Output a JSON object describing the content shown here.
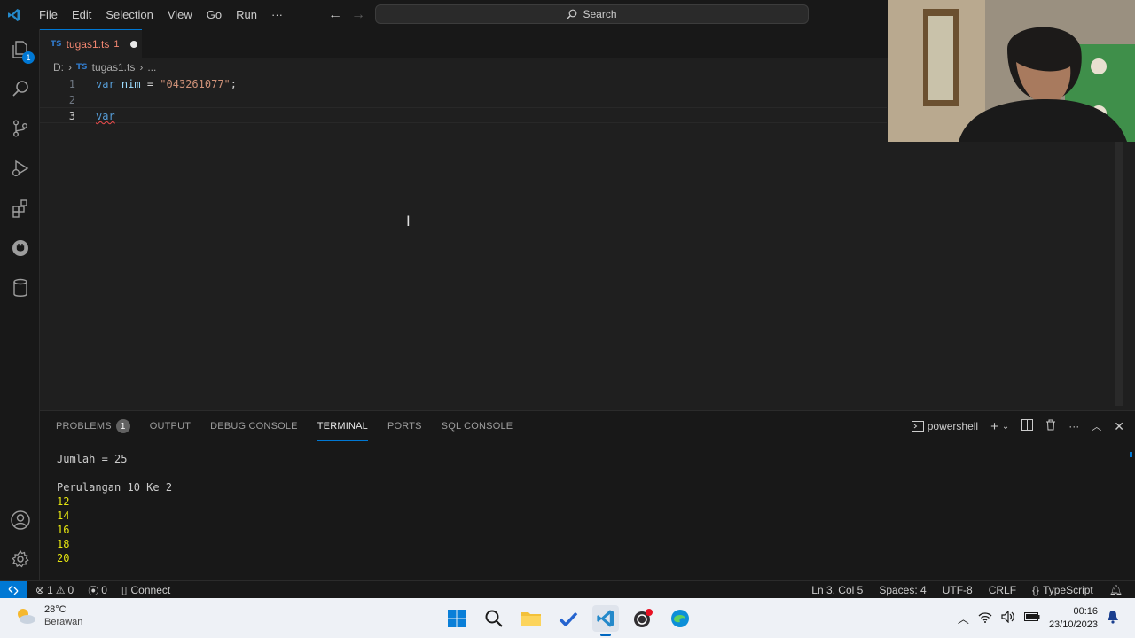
{
  "menu": [
    "File",
    "Edit",
    "Selection",
    "View",
    "Go",
    "Run",
    "···"
  ],
  "search": {
    "label": "Search"
  },
  "activity": {
    "explorer_badge": "1"
  },
  "tab": {
    "lang": "TS",
    "name": "tugas1.ts",
    "problem_count": "1"
  },
  "breadcrumb": {
    "drive": "D:",
    "lang": "TS",
    "file": "tugas1.ts",
    "more": "..."
  },
  "editor": {
    "lines": [
      {
        "no": "1",
        "kw": "var",
        "name": "nim",
        "op": " = ",
        "value": "\"043261077\"",
        "end": ";"
      },
      {
        "no": "2"
      },
      {
        "no": "3",
        "kw": "var"
      }
    ]
  },
  "panel": {
    "tabs": [
      "PROBLEMS",
      "OUTPUT",
      "DEBUG CONSOLE",
      "TERMINAL",
      "PORTS",
      "SQL CONSOLE"
    ],
    "problems_count": "1",
    "active_tab": "TERMINAL",
    "shell": "powershell",
    "terminal_lines": [
      {
        "text": "Jumlah = 25",
        "color": "normal"
      },
      {
        "text": "",
        "color": "normal"
      },
      {
        "text": "Perulangan 10 Ke 2",
        "color": "normal"
      },
      {
        "text": "12",
        "color": "yellow"
      },
      {
        "text": "14",
        "color": "yellow"
      },
      {
        "text": "16",
        "color": "yellow"
      },
      {
        "text": "18",
        "color": "yellow"
      },
      {
        "text": "20",
        "color": "yellow"
      },
      {
        "text": "------------------",
        "color": "normal"
      }
    ]
  },
  "status": {
    "errors": "1",
    "warnings": "0",
    "ports": "0",
    "connect": "Connect",
    "position": "Ln 3, Col 5",
    "spaces": "Spaces: 4",
    "encoding": "UTF-8",
    "eol": "CRLF",
    "language": "TypeScript"
  },
  "taskbar": {
    "temp": "28°C",
    "weather": "Berawan",
    "time": "00:16",
    "date": "23/10/2023"
  },
  "colors": {
    "accent": "#0078d4",
    "error": "#f48771",
    "keyword": "#569cd6",
    "string": "#ce9178",
    "terminal_yellow": "#e5e510"
  },
  "icons": [
    "vscode-logo-icon",
    "explorer-icon",
    "search-icon",
    "source-control-icon",
    "run-debug-icon",
    "extensions-icon",
    "remote-explorer-icon",
    "database-icon",
    "account-icon",
    "gear-icon"
  ]
}
